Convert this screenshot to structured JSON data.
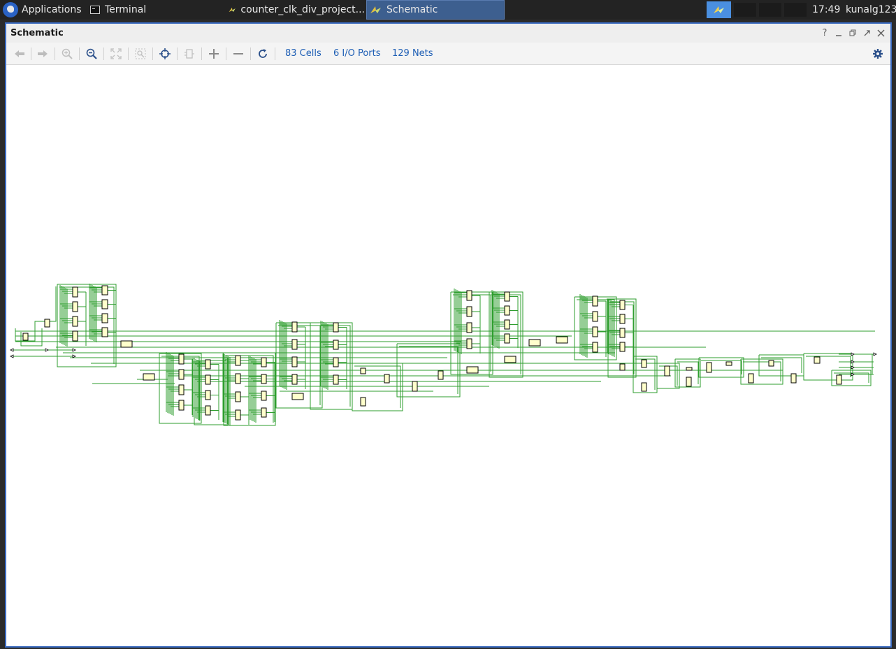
{
  "taskbar": {
    "applications_label": "Applications",
    "tasks": [
      {
        "label": "Terminal"
      },
      {
        "label": "counter_clk_div_project..."
      },
      {
        "label": "Schematic"
      }
    ],
    "clock": "17:49",
    "user": "kunalg123"
  },
  "window": {
    "title": "Schematic",
    "controls": [
      "help-icon",
      "minimize-icon",
      "restore-icon",
      "maximize-icon",
      "close-icon"
    ]
  },
  "toolbar": {
    "buttons": [
      "back-icon",
      "forward-icon",
      "zoom-in-icon",
      "zoom-out-icon",
      "zoom-fit-icon",
      "zoom-selection-icon",
      "select-icon",
      "collapse-icon",
      "expand-icon",
      "remove-icon",
      "refresh-icon",
      "settings-icon"
    ],
    "stats": {
      "cells": "83 Cells",
      "ports": "6 I/O Ports",
      "nets": "129 Nets"
    }
  },
  "colors": {
    "accent": "#1f5fb5",
    "wire": "#2e9e2e",
    "cell_fill": "#ffffcc",
    "window_border": "#3a6ac0"
  }
}
